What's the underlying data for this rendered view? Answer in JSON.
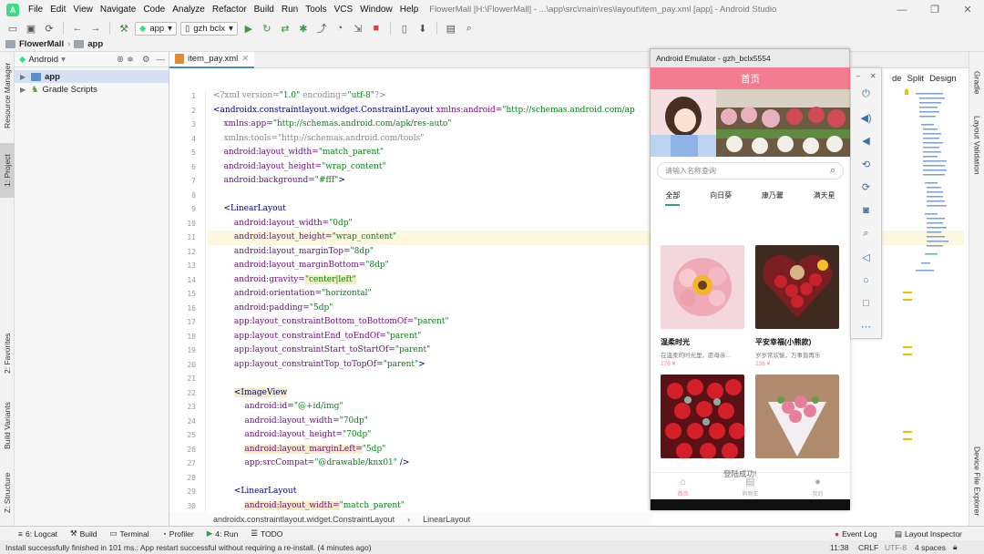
{
  "menu": [
    "File",
    "Edit",
    "View",
    "Navigate",
    "Code",
    "Analyze",
    "Refactor",
    "Build",
    "Run",
    "Tools",
    "VCS",
    "Window",
    "Help"
  ],
  "window_title": "FlowerMall [H:\\FlowerMall] - ...\\app\\src\\main\\res\\layout\\item_pay.xml [app] - Android Studio",
  "toolbar": {
    "module": "app",
    "device": "gzh bclx"
  },
  "breadcrumb": {
    "project": "FlowerMall",
    "module": "app"
  },
  "project_panel": {
    "view_label": "Android",
    "items": [
      {
        "label": "app"
      },
      {
        "label": "Gradle Scripts"
      }
    ]
  },
  "left_tabs": [
    "Resource Manager",
    "1: Project",
    "2: Favorites",
    "Build Variants",
    "Z: Structure"
  ],
  "right_tabs": [
    "Gradle",
    "Layout Validation",
    "Device File Explorer"
  ],
  "editor": {
    "tab": "item_pay.xml",
    "split_labels": [
      "de",
      "Split",
      "Design"
    ],
    "lines": [
      "1",
      "2",
      "3",
      "4",
      "5",
      "6",
      "7",
      "8",
      "9",
      "10",
      "11",
      "12",
      "13",
      "14",
      "15",
      "16",
      "17",
      "18",
      "19",
      "20",
      "21",
      "22",
      "23",
      "24",
      "25",
      "26",
      "27",
      "28",
      "29",
      "30"
    ],
    "breadcrumb": [
      "androidx.constraintlayout.widget.ConstraintLayout",
      "LinearLayout"
    ]
  },
  "code": {
    "l1a": "<?xml version=",
    "l1b": "\"1.0\"",
    "l1c": " encoding=",
    "l1d": "\"utf-8\"",
    "l1e": "?>",
    "l2a": "<androidx.constraintlayout.widget.ConstraintLayout ",
    "l2b": "xmlns:android=",
    "l2c": "\"http://schemas.android.com/ap",
    "l3a": "xmlns:app=",
    "l3b": "\"http://schemas.android.com/apk/res-auto\"",
    "l4a": "xmlns:tools=",
    "l4b": "\"http://schemas.android.com/tools\"",
    "l5a": "android:layout_width=",
    "l5b": "\"match_parent\"",
    "l6a": "android:layout_height=",
    "l6b": "\"wrap_content\"",
    "l7a": "android:background=",
    "l7b": "\"#fff\"",
    "l7c": ">",
    "l9": "<LinearLayout",
    "l10a": "android:layout_width=",
    "l10b": "\"0dp\"",
    "l11a": "android:layout_height=",
    "l11b": "\"wrap_content\"",
    "l12a": "android:layout_marginTop=",
    "l12b": "\"8dp\"",
    "l13a": "android:layout_marginBottom=",
    "l13b": "\"8dp\"",
    "l14a": "android:gravity=",
    "l14b": "\"center|left\"",
    "l15a": "android:orientation=",
    "l15b": "\"horizontal\"",
    "l16a": "android:padding=",
    "l16b": "\"5dp\"",
    "l17a": "app:layout_constraintBottom_toBottomOf=",
    "l17b": "\"parent\"",
    "l18a": "app:layout_constraintEnd_toEndOf=",
    "l18b": "\"parent\"",
    "l19a": "app:layout_constraintStart_toStartOf=",
    "l19b": "\"parent\"",
    "l20a": "app:layout_constraintTop_toTopOf=",
    "l20b": "\"parent\"",
    "l20c": ">",
    "l22": "<ImageView",
    "l23a": "android:id=",
    "l23b": "\"@+id/img\"",
    "l24a": "android:layout_width=",
    "l24b": "\"70dp\"",
    "l25a": "android:layout_height=",
    "l25b": "\"70dp\"",
    "l26a": "android:layout_marginLeft=",
    "l26b": "\"5dp\"",
    "l27a": "app:srcCompat=",
    "l27b": "\"@drawable/knx01\"",
    "l27c": " />",
    "l29": "<LinearLayout",
    "l30a": "android:layout_width=",
    "l30b": "\"match_parent\""
  },
  "emulator": {
    "title": "Android Emulator - gzh_bclx5554",
    "app_title": "首页",
    "search_placeholder": "请输入名称查询",
    "categories": [
      "全部",
      "向日葵",
      "康乃馨",
      "满天星"
    ],
    "products": [
      {
        "name": "温柔时光",
        "desc": "在温柔的时光里，愿母亲...",
        "price": "178 ¥"
      },
      {
        "name": "平安幸福(小熊款)",
        "desc": "岁岁常欢愉，万事皆再乐",
        "price": "238 ¥"
      },
      {
        "name": "",
        "desc": "",
        "price": ""
      },
      {
        "name": "",
        "desc": "",
        "price": ""
      }
    ],
    "toast": "登陆成功!",
    "nav": [
      "首页",
      "购物车",
      "我的"
    ]
  },
  "bottom_tools": [
    "6: Logcat",
    "Build",
    "Terminal",
    "Profiler",
    "4: Run",
    "TODO"
  ],
  "bottom_right": [
    "Event Log",
    "Layout Inspector"
  ],
  "status": {
    "message": "Install successfully finished in 101 ms.: App restart successful without requiring a re-install. (4 minutes ago)",
    "time": "11:38",
    "eol": "CRLF",
    "encoding": "UTF-8",
    "indent": "4 spaces"
  },
  "colors": {
    "app_bar": "#f47c91",
    "accent_green": "#3b9c7d",
    "android_green": "#3ddc84"
  }
}
